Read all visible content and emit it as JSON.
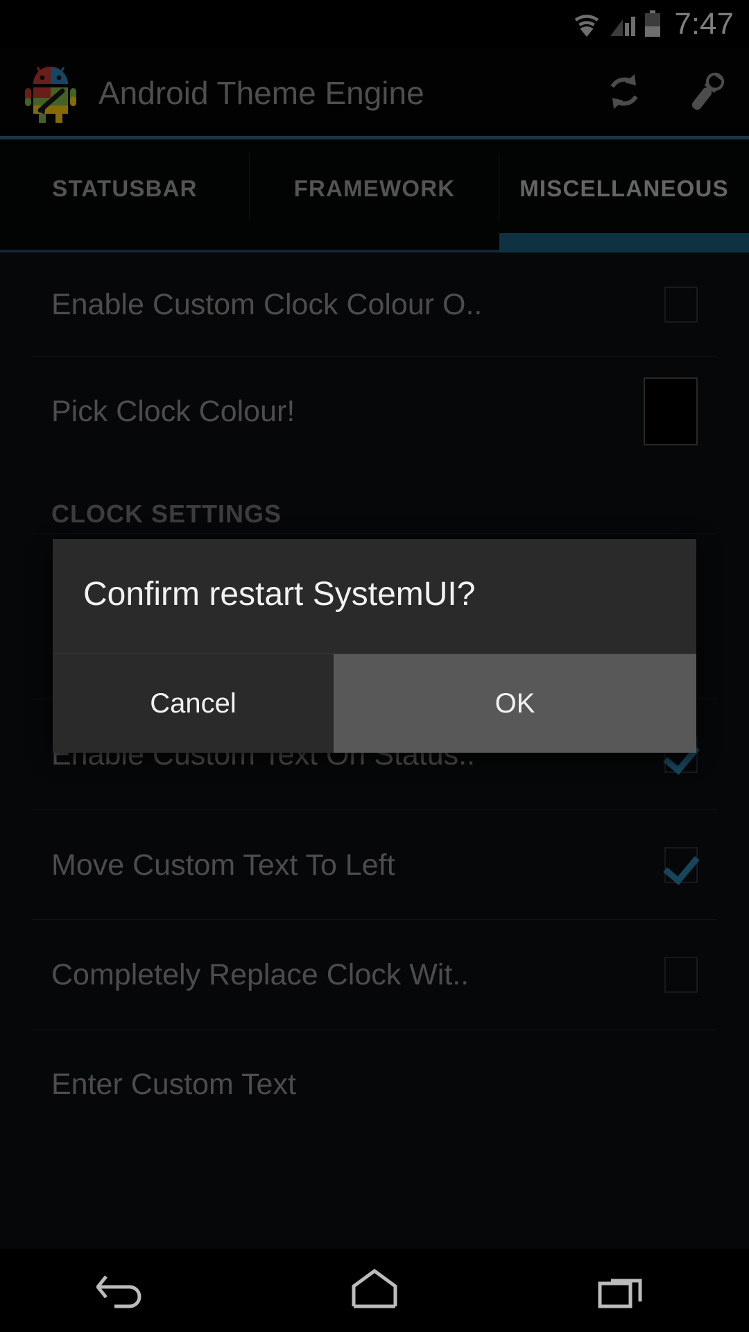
{
  "status_bar": {
    "time": "7:47",
    "icons": [
      "wifi-icon",
      "cellular-signal-icon",
      "battery-icon"
    ]
  },
  "action_bar": {
    "app_icon": "android-theme-engine-logo",
    "title": "Android Theme Engine",
    "actions": [
      {
        "name": "refresh-icon",
        "label": "Refresh"
      },
      {
        "name": "wrench-icon",
        "label": "Settings"
      }
    ],
    "accent_color": "#2c6479"
  },
  "tabs": {
    "active_index": 2,
    "items": [
      {
        "label": "STATUSBAR"
      },
      {
        "label": "FRAMEWORK"
      },
      {
        "label": "MISCELLANEOUS"
      }
    ],
    "indicator_color": "#1d5b78",
    "inactive_indicator_color": "#20495c"
  },
  "list": {
    "rows": [
      {
        "type": "checkbox",
        "label": "Enable Custom Clock Colour O..",
        "checked": false
      },
      {
        "type": "swatch",
        "label": "Pick Clock Colour!",
        "color": "#000000"
      },
      {
        "type": "header",
        "label": "CLOCK SETTINGS"
      },
      {
        "type": "checkbox",
        "label": "Enable Custom Text On Status..",
        "checked": true
      },
      {
        "type": "checkbox",
        "label": "Move Custom Text To Left",
        "checked": true
      },
      {
        "type": "checkbox",
        "label": "Completely Replace Clock Wit..",
        "checked": false
      },
      {
        "type": "plain",
        "label": "Enter Custom Text"
      }
    ],
    "check_color": "#2b7fa8"
  },
  "dialog": {
    "title": "Confirm restart SystemUI?",
    "cancel_label": "Cancel",
    "ok_label": "OK",
    "ok_pressed": true
  },
  "nav_bar": {
    "buttons": [
      {
        "name": "back-nav-icon",
        "label": "Back"
      },
      {
        "name": "home-nav-icon",
        "label": "Home"
      },
      {
        "name": "recents-nav-icon",
        "label": "Recents"
      }
    ]
  }
}
